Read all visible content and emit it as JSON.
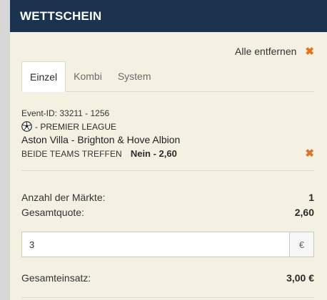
{
  "header": {
    "title": "WETTSCHEIN"
  },
  "actions": {
    "remove_all": "Alle entfernen",
    "remove_icon": "close-icon",
    "remove_glyph": "✖"
  },
  "tabs": [
    {
      "label": "Einzel",
      "active": true
    },
    {
      "label": "Kombi",
      "active": false
    },
    {
      "label": "System",
      "active": false
    }
  ],
  "bet": {
    "event_id": "Event-ID: 33211 - 1256",
    "league_icon": "soccer-ball-icon",
    "league": "- PREMIER LEAGUE",
    "match": "Aston Villa - Brighton & Hove Albion",
    "market": "BEIDE TEAMS TREFFEN",
    "selection": "Nein - 2,60"
  },
  "summary": {
    "markets_label": "Anzahl der Märkte:",
    "markets_value": "1",
    "odds_label": "Gesamtquote:",
    "odds_value": "2,60"
  },
  "stake": {
    "value": "3",
    "currency": "€"
  },
  "total": {
    "label": "Gesamteinsatz:",
    "value": "3,00 €"
  },
  "colors": {
    "header_bg": "#1c3350",
    "accent": "#e07422",
    "panel_bg": "#f4f0e2"
  }
}
